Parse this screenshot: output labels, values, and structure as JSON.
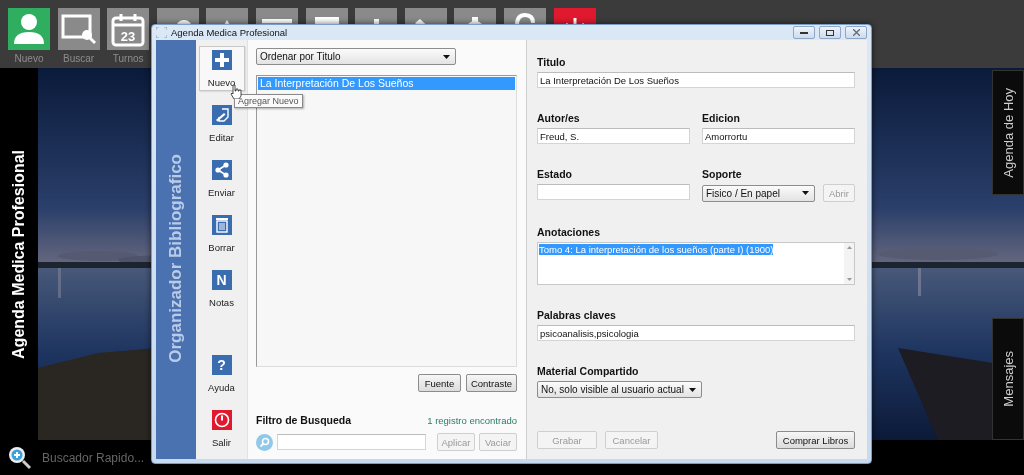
{
  "launcher": [
    {
      "kind": "user",
      "label": "Nuevo",
      "color": "#2fae60"
    },
    {
      "kind": "search",
      "label": "Buscar",
      "color": "#8a8a8a"
    },
    {
      "kind": "calendar",
      "label": "Turnos",
      "badge": "23",
      "color": "#8a8a8a"
    },
    {
      "kind": "people",
      "color": "#8a8a8a"
    },
    {
      "kind": "triangle",
      "color": "#8a8a8a"
    },
    {
      "kind": "table",
      "color": "#8a8a8a"
    },
    {
      "kind": "bar",
      "color": "#8a8a8a"
    },
    {
      "kind": "chart",
      "color": "#8a8a8a"
    },
    {
      "kind": "pencil",
      "color": "#8a8a8a"
    },
    {
      "kind": "gear",
      "color": "#8a8a8a"
    },
    {
      "kind": "help",
      "color": "#8a8a8a"
    },
    {
      "kind": "power",
      "color": "#e0192e"
    }
  ],
  "desktop_title": "Agenda Medica Profesional",
  "side_tabs": [
    {
      "label": "Agenda de Hoy"
    },
    {
      "label": "Mensajes"
    }
  ],
  "quick_search": {
    "placeholder": "Buscador Rapido..."
  },
  "window": {
    "title": "Agenda Medica Profesional",
    "module": "Organizador Bibliografico",
    "tools": [
      {
        "kind": "plus",
        "label": "Nuevo",
        "hovered": true
      },
      {
        "kind": "edit",
        "label": "Editar",
        "hovered": false
      },
      {
        "kind": "share",
        "label": "Enviar",
        "hovered": false
      },
      {
        "kind": "trash",
        "label": "Borrar",
        "hovered": false
      },
      {
        "kind": "glyph",
        "glyph": "N",
        "label": "Notas",
        "hovered": false
      }
    ],
    "bottom_tools": [
      {
        "kind": "glyph",
        "glyph": "?",
        "label": "Ayuda",
        "hovered": false
      },
      {
        "kind": "power",
        "label": "Salir",
        "hovered": false
      }
    ],
    "tooltip": "Agregar Nuevo",
    "sort": "Ordenar por Titulo",
    "list": [
      {
        "text": "La Interpretación De Los Sueños",
        "selected": true
      }
    ],
    "list_buttons": [
      "Fuente",
      "Contraste"
    ],
    "filter": {
      "title": "Filtro de Busqueda",
      "count": "1 registro encontrado",
      "buttons": [
        {
          "label": "Aplicar",
          "disabled": true
        },
        {
          "label": "Vaciar",
          "disabled": true
        }
      ]
    },
    "form": {
      "titulo": {
        "label": "Titulo",
        "value": "La Interpretación De Los Sueños"
      },
      "autor": {
        "label": "Autor/es",
        "value": "Freud, S."
      },
      "edicion": {
        "label": "Edicion",
        "value": "Amorrortu"
      },
      "estado": {
        "label": "Estado"
      },
      "soporte": {
        "label": "Soporte",
        "value": "Fisico / En papel",
        "button": {
          "label": "Abrir",
          "disabled": true
        }
      },
      "anotaciones": {
        "label": "Anotaciones",
        "value": "Tomo 4: La interpretación de los sueños (parte I) (1900)",
        "highlighted": true
      },
      "palabras": {
        "label": "Palabras claves",
        "value": "psicoanalisis,psicologia"
      },
      "material": {
        "label": "Material Compartido",
        "value": "No, solo visible al usuario actual"
      }
    },
    "actions": [
      {
        "label": "Grabar",
        "disabled": true
      },
      {
        "label": "Cancelar",
        "disabled": true
      },
      {
        "label": "Comprar Libros",
        "disabled": false
      }
    ]
  }
}
